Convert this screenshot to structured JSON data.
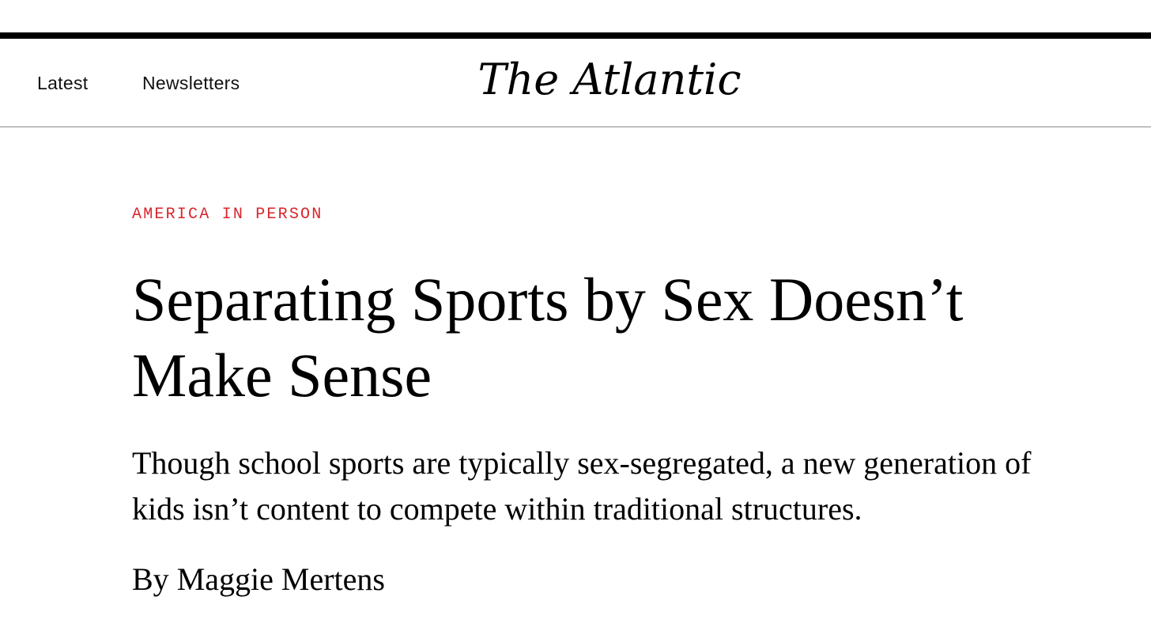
{
  "header": {
    "nav": [
      {
        "label": "Latest"
      },
      {
        "label": "Newsletters"
      }
    ],
    "logo": "The Atlantic"
  },
  "article": {
    "section": "AMERICA IN PERSON",
    "headline": "Separating Sports by Sex Doesn’t Make Sense",
    "dek": "Though school sports are typically sex-segregated, a new generation of kids isn’t content to compete within traditional structures.",
    "byline_prefix": "By",
    "author": "Maggie Mertens"
  },
  "colors": {
    "section_label": "#d9242b",
    "rule": "#000000"
  }
}
